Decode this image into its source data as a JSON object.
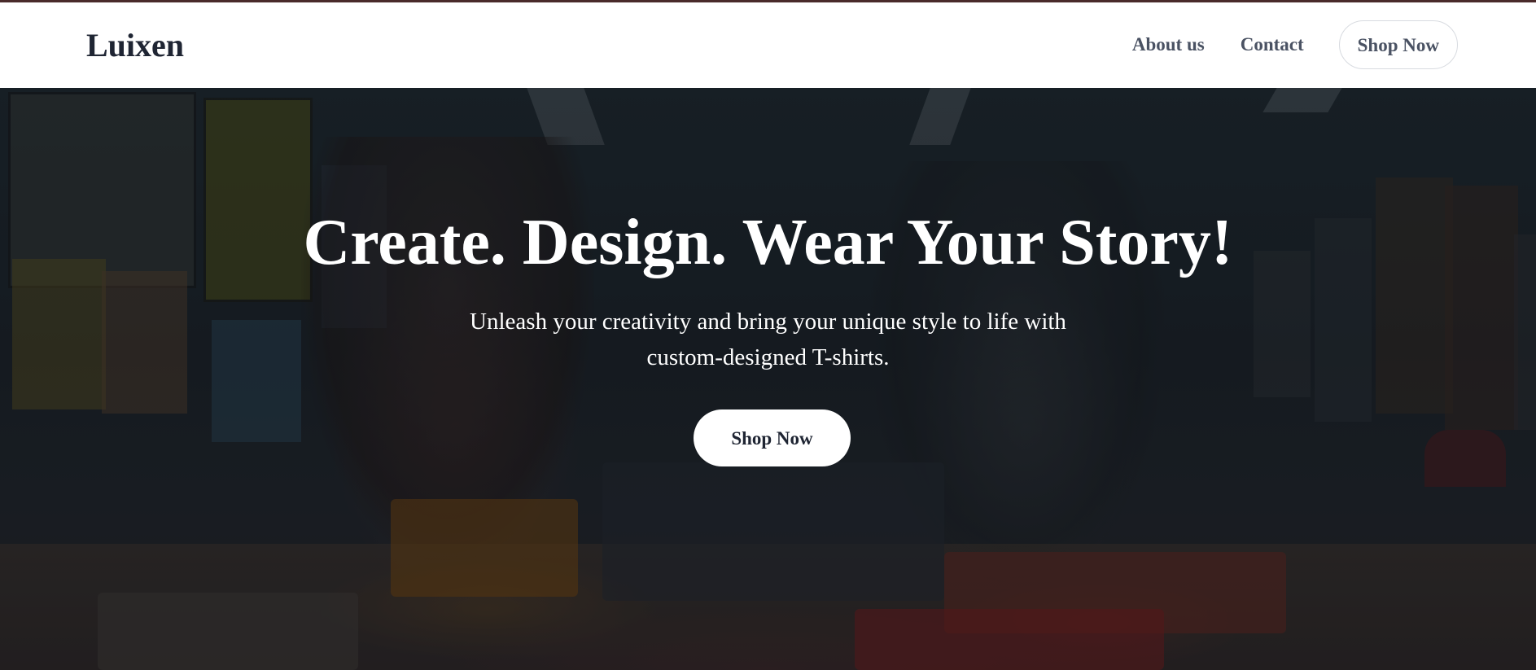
{
  "header": {
    "logo": "Luixen",
    "nav": {
      "about": "About us",
      "contact": "Contact",
      "shop": "Shop Now"
    }
  },
  "hero": {
    "title": "Create. Design. Wear Your Story!",
    "subtitle_line1": "Unleash your creativity and bring your unique style to life with",
    "subtitle_line2": "custom-designed T-shirts.",
    "cta": "Shop Now"
  },
  "colors": {
    "header_bg": "#ffffff",
    "logo_text": "#1f2533",
    "nav_text": "#4a5263",
    "hero_text": "#ffffff",
    "cta_bg": "#ffffff"
  }
}
